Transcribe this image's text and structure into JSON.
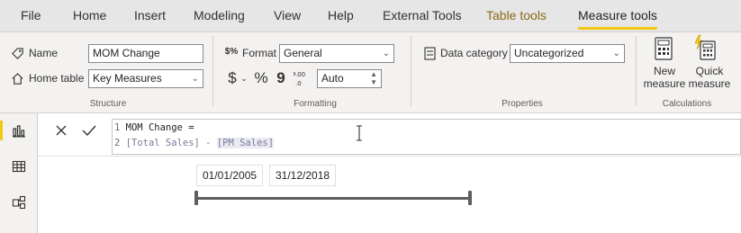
{
  "menu": {
    "tabs": [
      "File",
      "Home",
      "Insert",
      "Modeling",
      "View",
      "Help",
      "External Tools",
      "Table tools",
      "Measure tools"
    ],
    "active_tab": "Measure tools"
  },
  "structure": {
    "name_label": "Name",
    "name_value": "MOM Change",
    "home_table_label": "Home table",
    "home_table_value": "Key Measures",
    "group_label": "Structure"
  },
  "formatting": {
    "format_label": "Format",
    "format_value": "General",
    "currency_symbol": "$",
    "percent_symbol": "%",
    "comma_symbol": "9",
    "decimals_value": "Auto",
    "group_label": "Formatting"
  },
  "properties": {
    "data_category_label": "Data category",
    "data_category_value": "Uncategorized",
    "group_label": "Properties"
  },
  "calculations": {
    "new_measure_label": [
      "New",
      "measure"
    ],
    "quick_measure_label": [
      "Quick",
      "measure"
    ],
    "group_label": "Calculations"
  },
  "formula": {
    "line1_num": "1",
    "line1": "MOM Change =",
    "line2_num": "2",
    "line2_a": "[Total Sales] - ",
    "line2_b": "[PM Sales]"
  },
  "slicer": {
    "start_date": "01/01/2005",
    "end_date": "31/12/2018"
  },
  "colors": {
    "accent": "#f2c811",
    "context_tab": "#8a6a14"
  }
}
